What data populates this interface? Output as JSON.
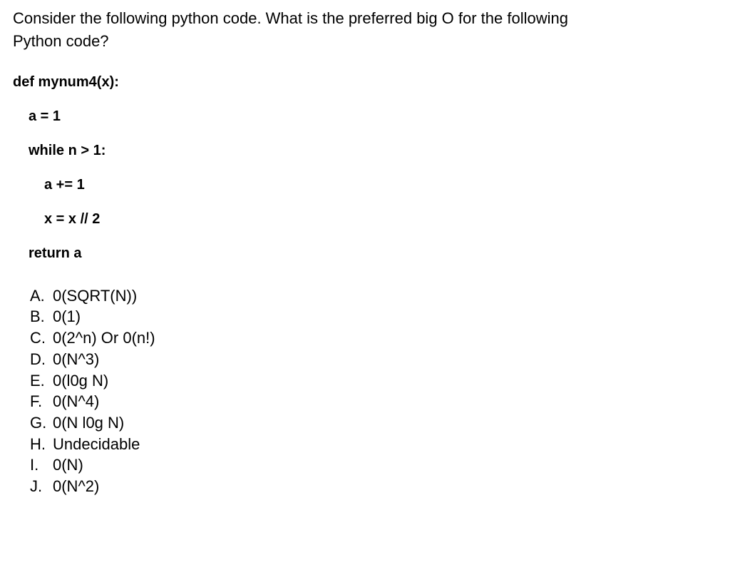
{
  "question": {
    "line1": "Consider the following python code. What is the preferred big O for the following",
    "line2": "Python code?"
  },
  "code": {
    "l0": "def mynum4(x):",
    "l1": "a = 1",
    "l2": "while n > 1:",
    "l3": "a += 1",
    "l4": "x = x // 2",
    "l5": "return a"
  },
  "options": [
    {
      "letter": "A.",
      "text": "0(SQRT(N))"
    },
    {
      "letter": "B.",
      "text": "0(1)"
    },
    {
      "letter": "C.",
      "text": "0(2^n) Or 0(n!)"
    },
    {
      "letter": "D.",
      "text": "0(N^3)"
    },
    {
      "letter": "E.",
      "text": "0(l0g N)"
    },
    {
      "letter": "F.",
      "text": "0(N^4)"
    },
    {
      "letter": "G.",
      "text": "0(N l0g N)"
    },
    {
      "letter": "H.",
      "text": "Undecidable"
    },
    {
      "letter": "I.",
      "text": "0(N)"
    },
    {
      "letter": "J.",
      "text": "0(N^2)"
    }
  ]
}
